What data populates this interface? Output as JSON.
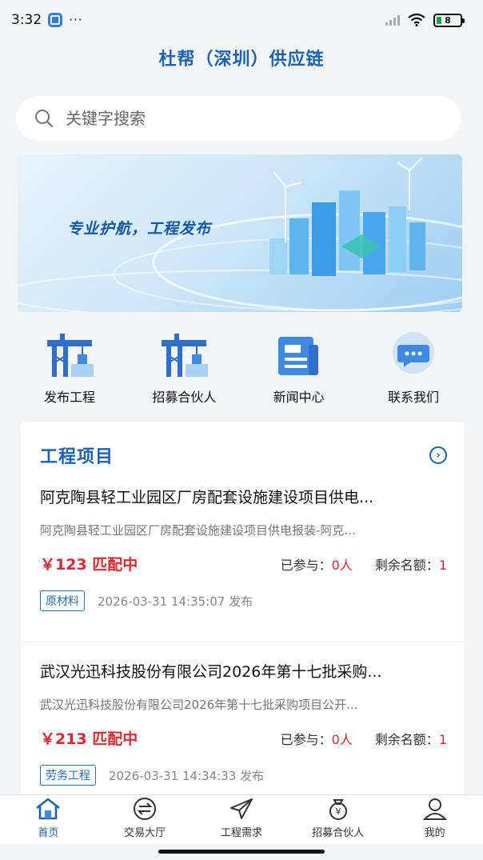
{
  "status_bar": {
    "time": "3:32",
    "dots": "···",
    "battery": "8"
  },
  "app": {
    "title": "杜帮（深圳）供应链"
  },
  "search": {
    "placeholder": "关键字搜索"
  },
  "banner": {
    "text": "专业护航，工程发布"
  },
  "quick_menu": [
    {
      "label": "发布工程",
      "icon": "crane-icon"
    },
    {
      "label": "招募合伙人",
      "icon": "crane-icon"
    },
    {
      "label": "新闻中心",
      "icon": "news-icon"
    },
    {
      "label": "联系我们",
      "icon": "chat-bubble-icon"
    }
  ],
  "projects": {
    "title": "工程项目",
    "items": [
      {
        "title": "阿克陶县轻工业园区厂房配套设施建设项目供电...",
        "desc": "阿克陶县轻工业园区厂房配套设施建设项目供电报装-阿克...",
        "price": "￥123 匹配中",
        "joined_label": "已参与：",
        "joined_value": "0人",
        "remaining_label": "剩余名额：",
        "remaining_value": "1",
        "tag": "原材料",
        "time": "2026-03-31 14:35:07 发布"
      },
      {
        "title": "武汉光迅科技股份有限公司2026年第十七批采购...",
        "desc": "武汉光迅科技股份有限公司2026年第十七批采购项目公开...",
        "price": "￥213 匹配中",
        "joined_label": "已参与：",
        "joined_value": "0人",
        "remaining_label": "剩余名额：",
        "remaining_value": "1",
        "tag": "劳务工程",
        "time": "2026-03-31 14:34:33 发布"
      }
    ]
  },
  "tabs": [
    {
      "label": "首页",
      "icon": "home-icon",
      "active": true
    },
    {
      "label": "交易大厅",
      "icon": "exchange-icon",
      "active": false
    },
    {
      "label": "工程需求",
      "icon": "paper-plane-icon",
      "active": false
    },
    {
      "label": "招募合伙人",
      "icon": "money-bag-icon",
      "active": false
    },
    {
      "label": "我的",
      "icon": "user-icon",
      "active": false
    }
  ],
  "colors": {
    "primary": "#1c62b4",
    "price_red": "#e0282e",
    "background": "#f3f4f6"
  }
}
